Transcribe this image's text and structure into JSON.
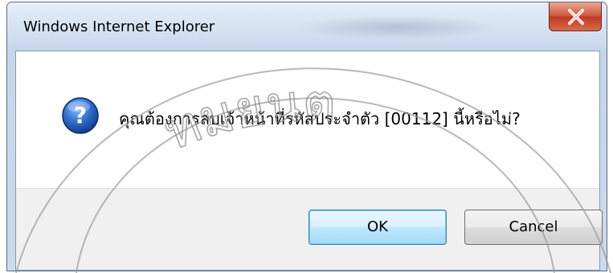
{
  "window": {
    "title": "Windows Internet Explorer",
    "close_icon": "close-icon"
  },
  "dialog": {
    "icon": "question-icon",
    "message": "คุณต้องการลบเจ้าหน้าที่รหัสประจำตัว [00112] นี้หรือไม่?"
  },
  "buttons": {
    "ok_label": "OK",
    "cancel_label": "Cancel"
  },
  "watermark": {
    "text": "ทมยนต"
  },
  "colors": {
    "close_button": "#c8462c",
    "question_icon": "#1a5fb4",
    "ok_border": "#3c7fb1"
  }
}
